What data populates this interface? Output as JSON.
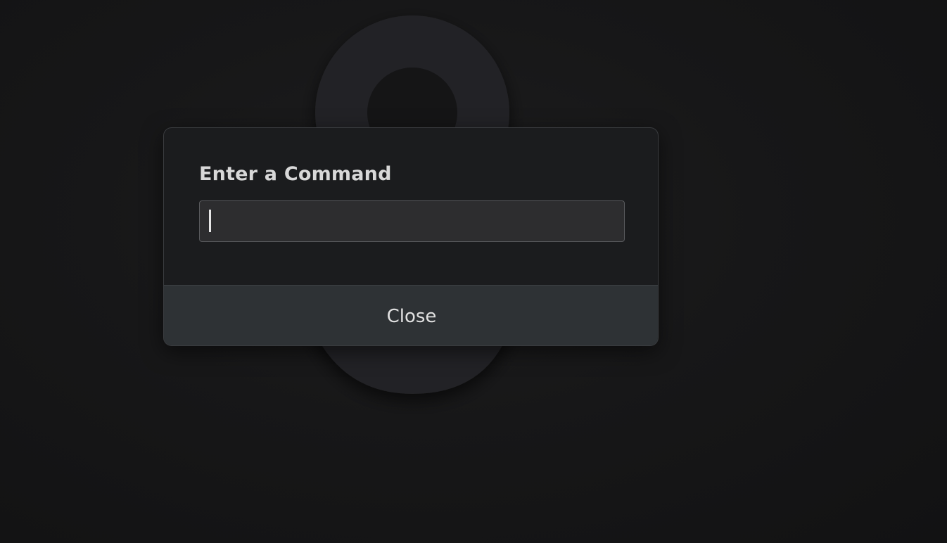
{
  "dialog": {
    "title": "Enter a Command",
    "input": {
      "value": "",
      "placeholder": ""
    },
    "close_label": "Close"
  },
  "colors": {
    "background": "#151516",
    "dialog_bg": "#1b1c1e",
    "input_bg": "#2d2d2f",
    "footer_bg": "#2e3235",
    "text": "#d8d8d8"
  },
  "icons": {
    "wallpaper": "distro-logo-icon"
  }
}
